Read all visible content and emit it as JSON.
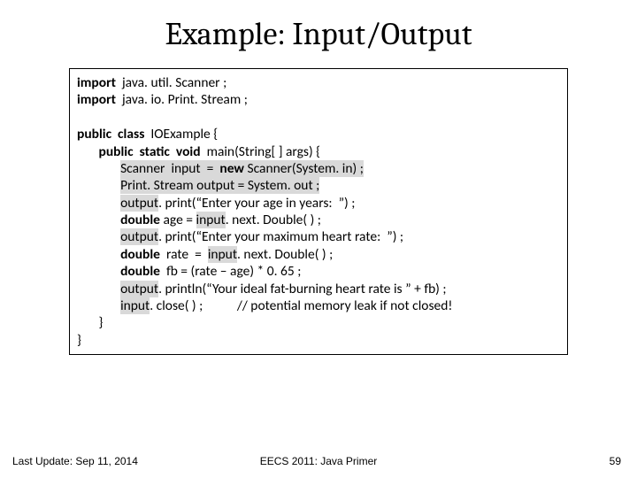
{
  "title": "Example:  Input/Output",
  "code": {
    "l1_k": "import",
    "l1_r": "  java. util. Scanner ; ",
    "l2_k": "import",
    "l2_r": "  java. io. Print. Stream ;",
    "l4_k": "public  class",
    "l4_r": "  IOExample {",
    "l5_pre": "       ",
    "l5_k": "public  static  void",
    "l5_r": "  main(String[ ] args) {",
    "l6_pre": "              ",
    "l6_hl": "Scanner  input  =  ",
    "l6_k": "new",
    "l6_hl2": " Scanner(System. in) ;",
    "l7_pre": "              ",
    "l7_hl": "Print. Stream output = System. out ;",
    "l8_pre": "              ",
    "l8_hl": "output",
    "l8_r": ". print(“Enter your age in years:  ”) ;",
    "l9_pre": "              ",
    "l9_k": "double",
    "l9_m": " age = ",
    "l9_hl": "input",
    "l9_r": ". next. Double( ) ;",
    "l10_pre": "              ",
    "l10_hl": "output",
    "l10_r": ". print(“Enter your maximum heart rate:  ”) ;",
    "l11_pre": "              ",
    "l11_k": "double",
    "l11_m": "  rate  =  ",
    "l11_hl": "input",
    "l11_r": ". next. Double( ) ;",
    "l12_pre": "              ",
    "l12_k": "double",
    "l12_r": "  fb = (rate – age) * 0. 65 ;",
    "l13_pre": "              ",
    "l13_hl": "output",
    "l13_r": ". println(“Your ideal fat-burning heart rate is ” + fb) ;",
    "l14_pre": "              ",
    "l14_hl": "input",
    "l14_r": ". close( ) ;           // potential memory leak if not closed!",
    "l15": "       }",
    "l16": "}"
  },
  "footer": {
    "left": "Last Update: Sep 11, 2014",
    "center": "EECS 2011: Java Primer",
    "right": "59"
  }
}
